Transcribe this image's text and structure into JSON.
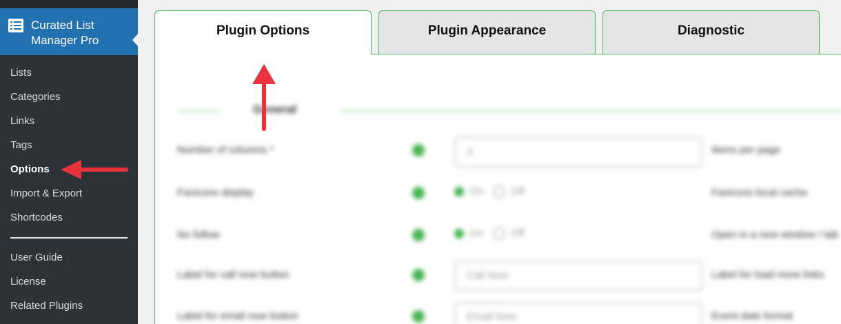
{
  "sidebar": {
    "title": "Curated List Manager Pro",
    "menu": [
      "Lists",
      "Categories",
      "Links",
      "Tags",
      "Options",
      "Import & Export",
      "Shortcodes"
    ],
    "menu2": [
      "User Guide",
      "License",
      "Related Plugins"
    ],
    "active_item": "Options"
  },
  "tabs": [
    "Plugin Options",
    "Plugin Appearance",
    "Diagnostic"
  ],
  "active_tab": "Plugin Options",
  "section": {
    "title": "General"
  },
  "rows": [
    {
      "label": "Number of columns *",
      "control": "input",
      "value": "3",
      "right_label": "Items per page"
    },
    {
      "label": "Favicons display",
      "control": "radio",
      "on": "On",
      "off": "Off",
      "right_label": "Favicons local cache"
    },
    {
      "label": "No follow",
      "control": "radio",
      "on": "On",
      "off": "Off",
      "right_label": "Open in a new window / tab"
    },
    {
      "label": "Label for call now button",
      "control": "input",
      "value": "Call Now",
      "right_label": "Label for load more links"
    },
    {
      "label": "Label for email now button",
      "control": "input",
      "value": "Email Now",
      "right_label": "Event date format"
    }
  ],
  "colors": {
    "sidebar_bg": "#2c3338",
    "sidebar_active": "#2271b1",
    "accent_green": "#46b450",
    "arrow_red": "#e8323c"
  },
  "icons": {
    "plugin_icon": "list-icon",
    "annotation": "red-arrow-icon"
  }
}
